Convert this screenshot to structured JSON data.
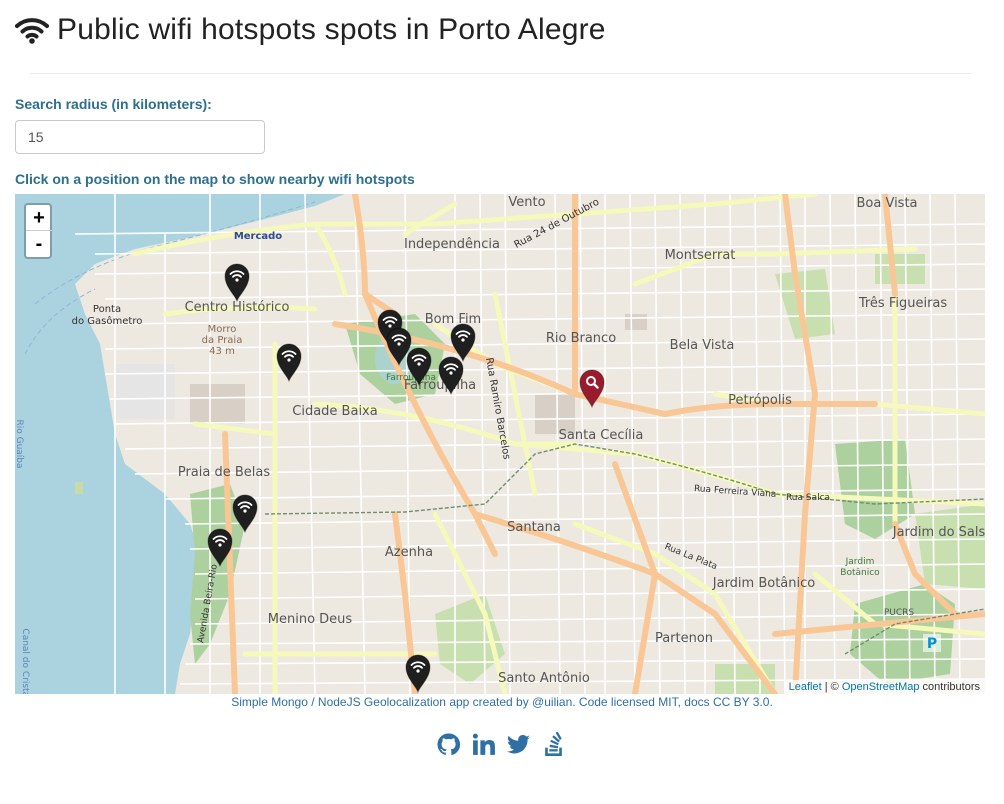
{
  "page": {
    "title": "Public wifi hotspots spots in Porto Alegre"
  },
  "form": {
    "radius_label": "Search radius (in kilometers):",
    "radius_value": "15",
    "map_instruction": "Click on a position on the map to show nearby wifi hotspots"
  },
  "map": {
    "zoom_in": "+",
    "zoom_out": "-",
    "attribution": {
      "leaflet": "Leaflet",
      "separator": " | © ",
      "osm": "OpenStreetMap",
      "suffix": " contributors"
    },
    "places": {
      "mercado": "Mercado",
      "ponta1": "Ponta",
      "ponta2": "do Gasômetro",
      "centro": "Centro Histórico",
      "morro1": "Morro",
      "morro2": "da Praia",
      "morro3": "43 m",
      "independencia": "Independência",
      "vento": "Vento",
      "rua24": "Rua 24 de Outubro",
      "montserrat": "Montserrat",
      "boavista": "Boa Vista",
      "tres": "Três Figueiras",
      "bomfim": "Bom Fim",
      "riobranco": "Rio Branco",
      "belavista": "Bela Vista",
      "farroupilha": "Farroupilha",
      "farrou_park": "Farroupilha",
      "cidadebaixa": "Cidade Baixa",
      "ramiro": "Rua Ramiro Barcelos",
      "petropolis": "Petrópolis",
      "santacecilia": "Santa Cecília",
      "praiadebelas": "Praia de Belas",
      "ferreira": "Rua Ferreira Viana",
      "salca": "Rua Salca",
      "jardimsal": "Jardim do Salso",
      "santana": "Santana",
      "azenha": "Azenha",
      "laplata": "Rua La Plata",
      "jardimbot": "Jardim Botânico",
      "jardimbot2a": "Jardim",
      "jardimbot2b": "Botânico",
      "pucrs": "PUCRS",
      "menino": "Menino Deus",
      "partenon": "Partenon",
      "santoantonio": "Santo Antônio",
      "beirario": "Avenida Beira-Rio",
      "canal": "Canal do Cristal",
      "guaiba": "Rio Guaíba",
      "parking": "P"
    }
  },
  "footer": {
    "credits": "Simple Mongo / NodeJS Geolocalization app created by @uilian. Code licensed MIT, docs CC BY 3.0."
  },
  "social": [
    "github-icon",
    "linkedin-icon",
    "twitter-icon",
    "stackoverflow-icon"
  ],
  "colors": {
    "label": "#2d6f8c",
    "link": "#2e6fa5",
    "marker_wifi": "#1f1f1f",
    "marker_search": "#9b1b2e"
  }
}
